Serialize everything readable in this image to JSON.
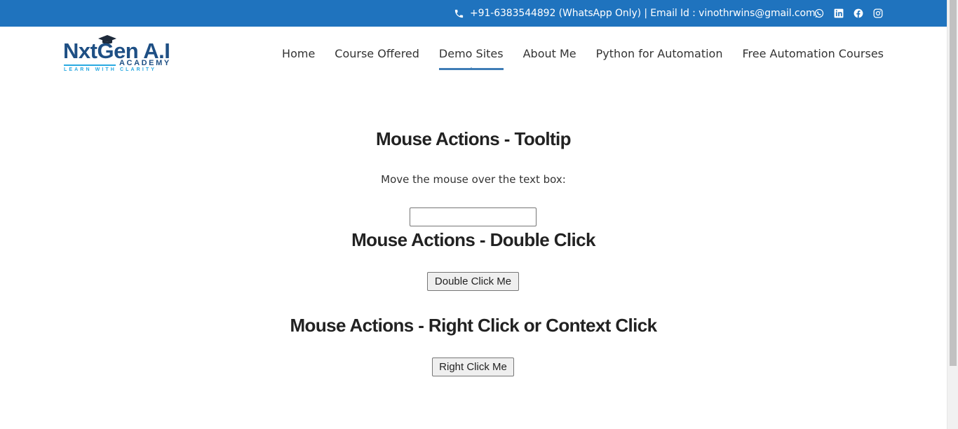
{
  "topbar": {
    "contact": "+91-6383544892 (WhatsApp Only) | Email Id : vinothrwins@gmail.com",
    "icons": [
      "phone-icon",
      "whatsapp-icon",
      "linkedin-icon",
      "facebook-icon",
      "instagram-icon"
    ],
    "color": "#1f73be"
  },
  "logo": {
    "brand": "NxtGen A.I",
    "academy": "ACADEMY",
    "tagline": "LEARN WITH CLARITY"
  },
  "nav": {
    "items": [
      {
        "label": "Home"
      },
      {
        "label": "Course Offered"
      },
      {
        "label": "Demo Sites"
      },
      {
        "label": "About Me"
      },
      {
        "label": "Python for Automation"
      },
      {
        "label": "Free Automation Courses"
      }
    ],
    "active": "Demo Sites",
    "active_color": "#3f7db6"
  },
  "main": {
    "tooltip_heading": "Mouse Actions - Tooltip",
    "tooltip_instruction": "Move the mouse over the text box:",
    "tooltip_input_value": "",
    "double_click_heading": "Mouse Actions - Double Click",
    "double_click_button": "Double Click Me",
    "right_click_heading": "Mouse Actions - Right Click or Context Click",
    "right_click_button": "Right Click Me"
  }
}
